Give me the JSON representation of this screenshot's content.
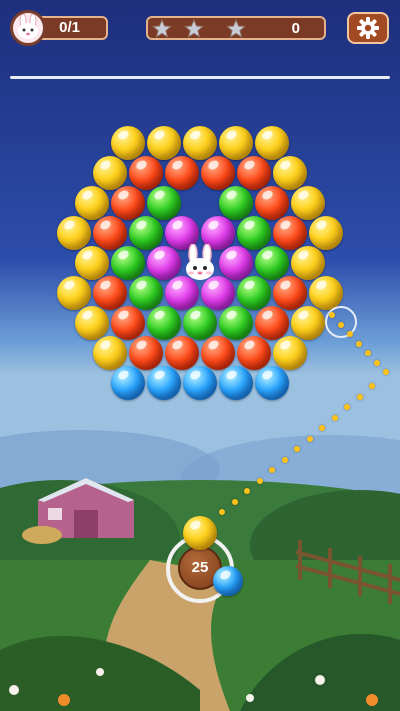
{
  "hud": {
    "progress_text": "0/1",
    "score_text": "0",
    "stars_earned": 0,
    "stars_total": 3,
    "settings_icon": "gear-icon",
    "avatar_icon": "bunny-face-icon"
  },
  "colors": {
    "pill_bg": "#7b3a25",
    "pill_border": "#e4b28d",
    "yellow": "#ffd21e",
    "red": "#ff4a1a",
    "green": "#2fce22",
    "purple": "#e03bea",
    "blue": "#2aa5ff"
  },
  "board": {
    "rows": [
      [
        "yellow",
        "yellow",
        "yellow",
        "yellow",
        "yellow"
      ],
      [
        "yellow",
        "red",
        "red",
        "red",
        "red",
        "yellow"
      ],
      [
        "yellow",
        "red",
        "green",
        "",
        "green",
        "red",
        "yellow"
      ],
      [
        "yellow",
        "red",
        "green",
        "purple",
        "purple",
        "green",
        "red",
        "yellow"
      ],
      [
        "yellow",
        "green",
        "purple",
        "bunny",
        "purple",
        "green",
        "yellow"
      ],
      [
        "yellow",
        "red",
        "green",
        "purple",
        "purple",
        "green",
        "red",
        "yellow"
      ],
      [
        "yellow",
        "red",
        "green",
        "green",
        "green",
        "red",
        "yellow"
      ],
      [
        "yellow",
        "red",
        "red",
        "red",
        "red",
        "yellow"
      ],
      [
        "blue",
        "blue",
        "blue",
        "blue",
        "blue"
      ]
    ]
  },
  "shooter": {
    "moves_left": "25",
    "current_bubble": "yellow",
    "next_bubble": "blue"
  }
}
